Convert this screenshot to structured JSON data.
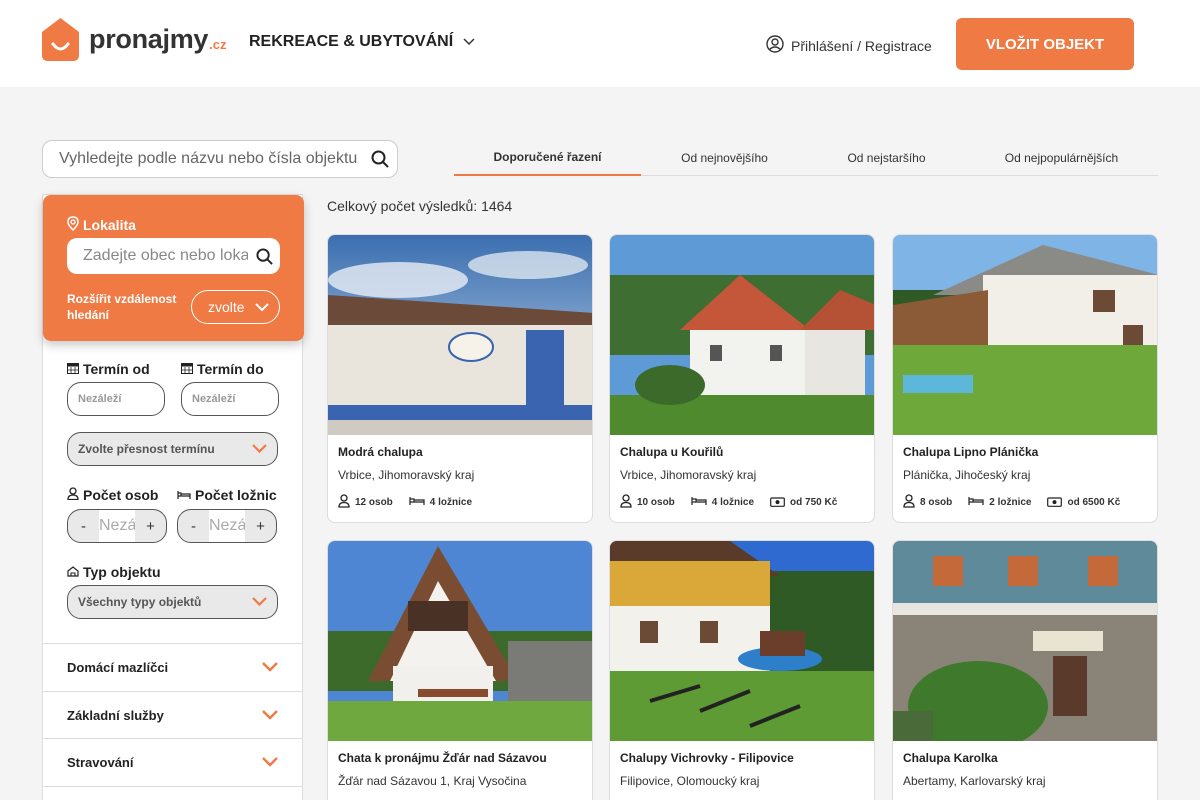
{
  "header": {
    "logo_text": "pronajmy",
    "logo_tld": ".cz",
    "category": "REKREACE & UBYTOVÁNÍ",
    "login": "Přihlášení / Registrace",
    "add_button": "VLOŽIT OBJEKT"
  },
  "colors": {
    "accent": "#f07a44"
  },
  "search": {
    "placeholder": "Vyhledejte podle názvu nebo čísla objektu"
  },
  "sort": {
    "tabs": [
      "Doporučené řazení",
      "Od nejnovějšího",
      "Od nejstaršího",
      "Od nejpopulárnějších"
    ],
    "active": 0
  },
  "results_count": "Celkový počet výsledků: 1464",
  "filter": {
    "location_label": "Lokalita",
    "location_placeholder": "Zadejte obec nebo lokalitu",
    "radius_label": "Rozšířit vzdálenost hledání",
    "radius_value": "zvolte",
    "date_from_label": "Termín od",
    "date_to_label": "Termín do",
    "date_placeholder": "Nezáleží",
    "date_precision": "Zvolte přesnost termínu",
    "persons_label": "Počet osob",
    "bedrooms_label": "Počet ložnic",
    "stepper_placeholder": "Nezáleží",
    "minus": "-",
    "plus": "+",
    "type_label": "Typ objektu",
    "type_value": "Všechny typy objektů",
    "accordions": [
      "Domácí mazlíčci",
      "Základní služby",
      "Stravování"
    ]
  },
  "listings": [
    {
      "title": "Modrá chalupa",
      "location": "Vrbice, Jihomoravský kraj",
      "persons": "12 osob",
      "bedrooms": "4 ložnice",
      "price": ""
    },
    {
      "title": "Chalupa u Kouřilů",
      "location": "Vrbice, Jihomoravský kraj",
      "persons": "10 osob",
      "bedrooms": "4 ložnice",
      "price": "od 750 Kč"
    },
    {
      "title": "Chalupa Lipno Plánička",
      "location": "Plánička, Jihočeský kraj",
      "persons": "8 osob",
      "bedrooms": "2 ložnice",
      "price": "od 6500 Kč"
    },
    {
      "title": "Chata k pronájmu Žďár nad Sázavou",
      "location": "Žďár nad Sázavou 1, Kraj Vysočina"
    },
    {
      "title": "Chalupy Vichrovky - Filipovice",
      "location": "Filipovice, Olomoucký kraj"
    },
    {
      "title": "Chalupa Karolka",
      "location": "Abertamy, Karlovarský kraj"
    }
  ]
}
